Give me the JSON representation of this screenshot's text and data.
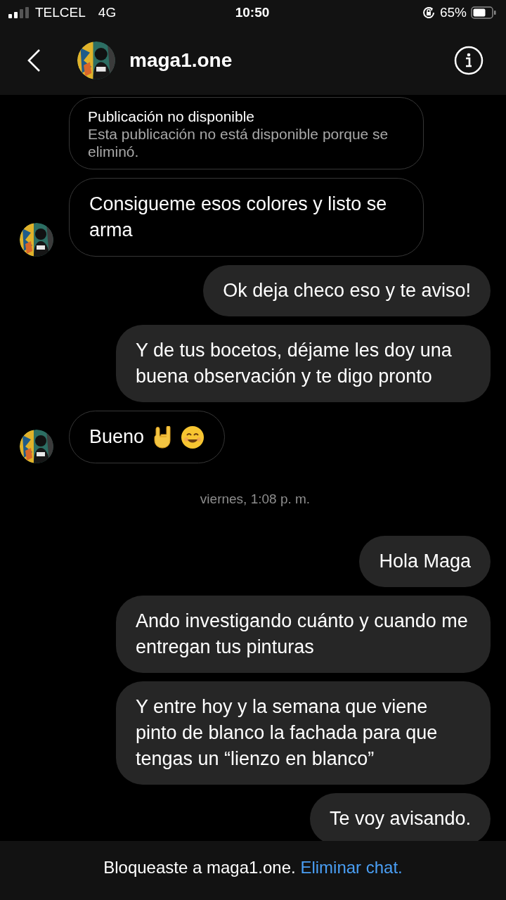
{
  "status_bar": {
    "carrier": "TELCEL",
    "network": "4G",
    "time": "10:50",
    "battery": "65%"
  },
  "header": {
    "username": "maga1.one"
  },
  "messages": [
    {
      "kind": "unavailable_post",
      "title": "Publicación no disponible",
      "body": "Esta publicación no está disponible porque se eliminó.",
      "show_avatar": false
    },
    {
      "kind": "received",
      "text": "Consigueme esos colores y listo se arma",
      "show_avatar": true
    },
    {
      "kind": "sent",
      "text": "Ok deja checo eso y te aviso!"
    },
    {
      "kind": "sent",
      "text": "Y de tus bocetos, déjame les doy una buena observación y te digo pronto"
    },
    {
      "kind": "received_with_emoji",
      "text": "Bueno",
      "show_avatar": true
    },
    {
      "kind": "date",
      "text": "viernes, 1:08 p. m."
    },
    {
      "kind": "sent",
      "text": "Hola Maga"
    },
    {
      "kind": "sent",
      "text": "Ando investigando cuánto y cuando me entregan tus pinturas"
    },
    {
      "kind": "sent",
      "text": "Y entre hoy y la semana que viene pinto de blanco la fachada para que tengas un “lienzo en blanco”"
    },
    {
      "kind": "sent",
      "text": "Te voy avisando."
    }
  ],
  "footer": {
    "text": "Bloqueaste a maga1.one.",
    "link": "Eliminar chat."
  }
}
